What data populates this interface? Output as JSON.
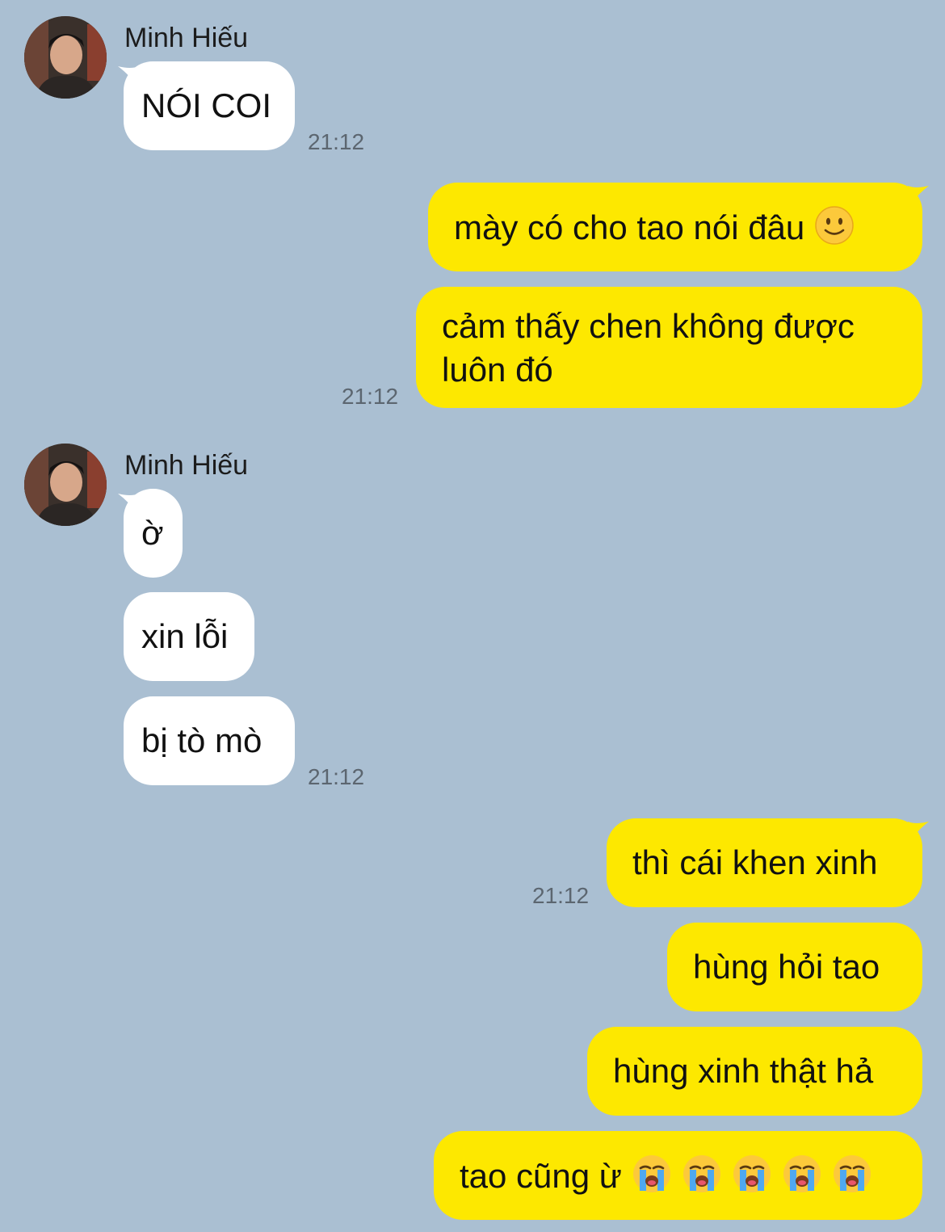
{
  "contact": {
    "name": "Minh Hiếu"
  },
  "messages": {
    "m1": {
      "text": "NÓI COI",
      "time": "21:12"
    },
    "m2": {
      "text": "mày có cho tao nói đâu"
    },
    "m3": {
      "line1": "cảm thấy chen không được",
      "line2": "luôn đó",
      "time": "21:12"
    },
    "m4": {
      "text": "ờ"
    },
    "m5": {
      "text": "xin lỗi"
    },
    "m6": {
      "text": "bị tò mò",
      "time": "21:12"
    },
    "m7": {
      "text": "thì cái khen xinh",
      "time": "21:12"
    },
    "m8": {
      "text": "hùng hỏi tao"
    },
    "m9": {
      "text": "hùng xinh thật hả"
    },
    "m10": {
      "text": "tao cũng ừ"
    }
  },
  "icons": {
    "avatar": "avatar-photo",
    "smile": "slightly-smiling-face-icon",
    "cry": "loudly-crying-face-icon"
  },
  "colors": {
    "background": "#aabfd2",
    "incoming_bubble": "#ffffff",
    "outgoing_bubble": "#fde800",
    "timestamp": "#5c6670"
  }
}
